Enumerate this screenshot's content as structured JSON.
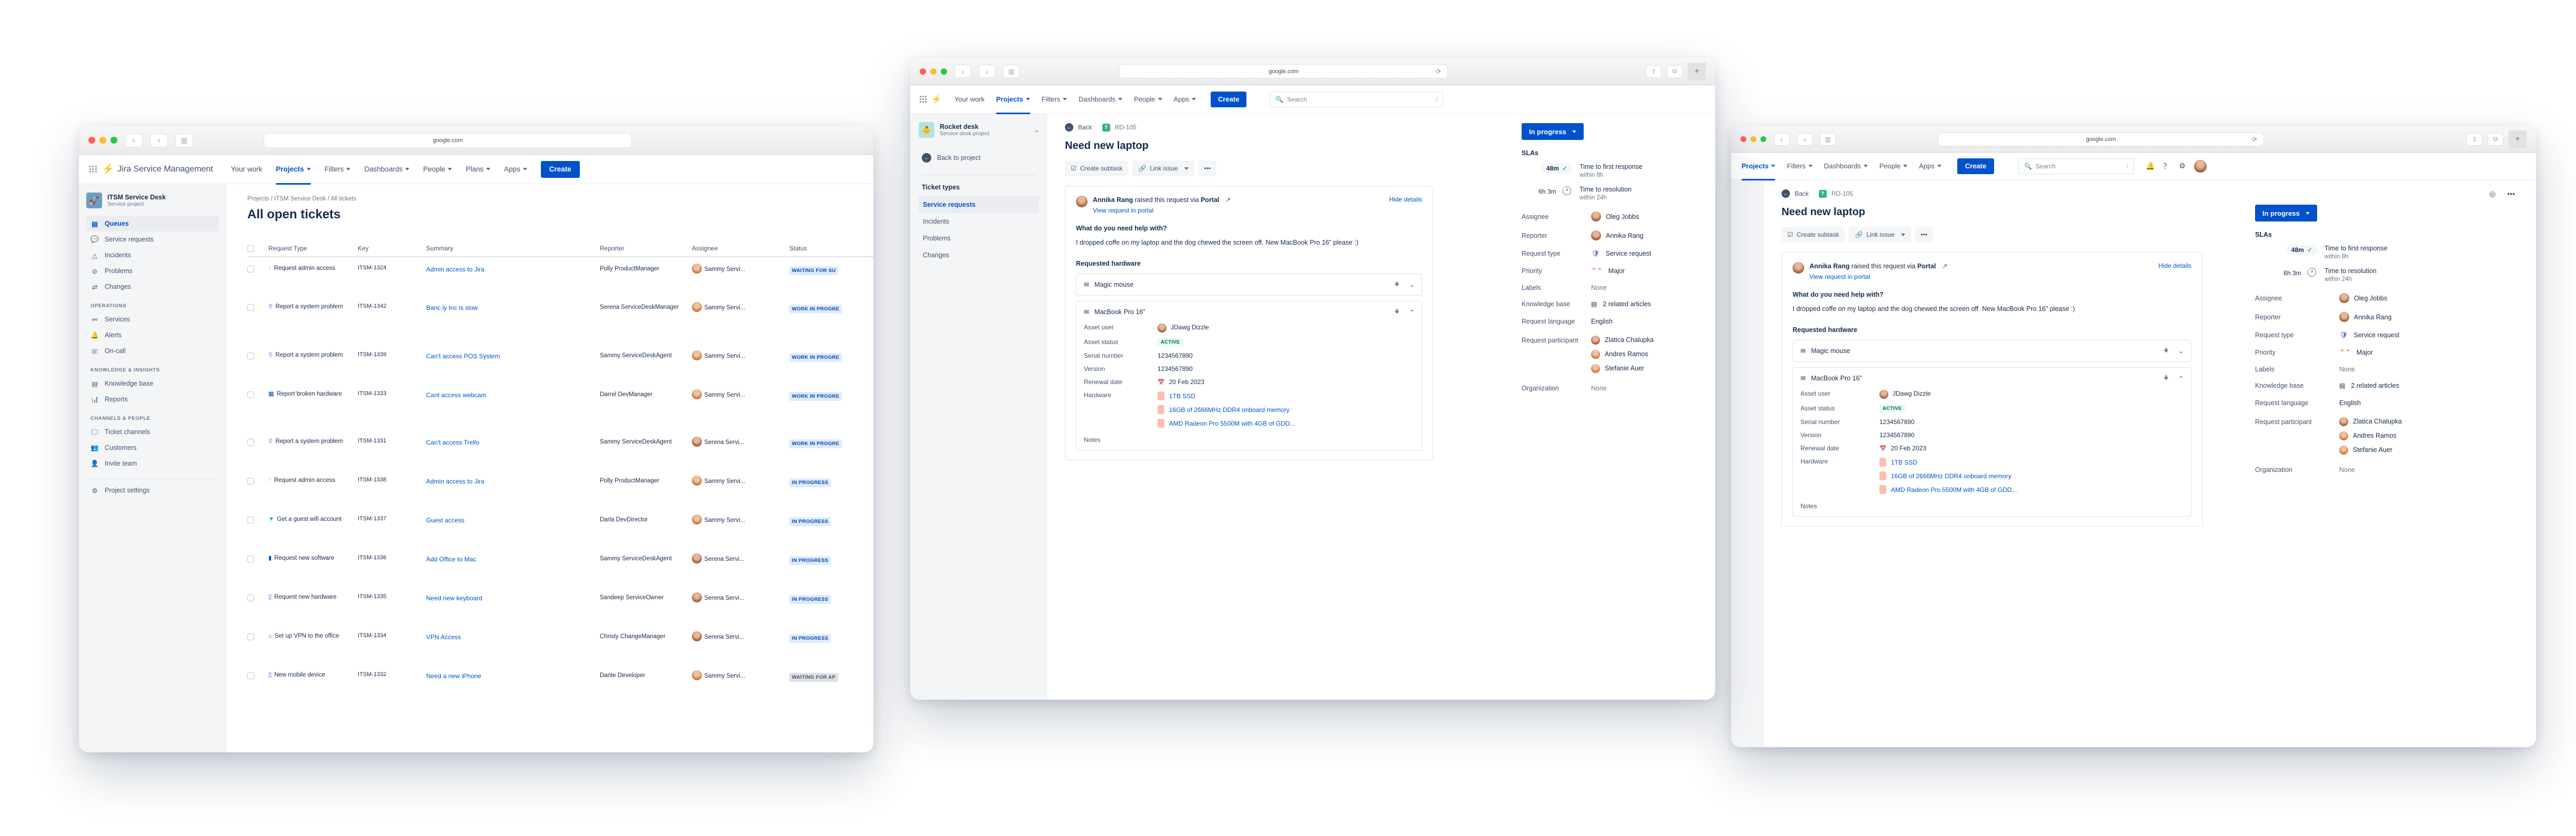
{
  "browser": {
    "url": "google.com"
  },
  "window1": {
    "brand": "Jira Service Management",
    "nav": [
      {
        "label": "Your work",
        "caret": false,
        "active": false
      },
      {
        "label": "Projects",
        "caret": true,
        "active": true
      },
      {
        "label": "Filters",
        "caret": true,
        "active": false
      },
      {
        "label": "Dashboards",
        "caret": true,
        "active": false
      },
      {
        "label": "People",
        "caret": true,
        "active": false
      },
      {
        "label": "Plans",
        "caret": true,
        "active": false
      },
      {
        "label": "Apps",
        "caret": true,
        "active": false
      }
    ],
    "create_label": "Create",
    "sidebar": {
      "project_name": "ITSM Service Desk",
      "project_type": "Service project",
      "items": [
        {
          "label": "Queues",
          "icon": "queues-icon",
          "selected": true
        },
        {
          "label": "Service requests",
          "icon": "chat-icon",
          "selected": false
        },
        {
          "label": "Incidents",
          "icon": "warning-icon",
          "selected": false
        },
        {
          "label": "Problems",
          "icon": "forbidden-icon",
          "selected": false
        },
        {
          "label": "Changes",
          "icon": "shuffle-icon",
          "selected": false
        }
      ],
      "sections": [
        {
          "title": "OPERATIONS",
          "items": [
            {
              "label": "Services",
              "icon": "services-icon"
            },
            {
              "label": "Alerts",
              "icon": "bell-icon"
            },
            {
              "label": "On-call",
              "icon": "oncall-icon"
            }
          ]
        },
        {
          "title": "KNOWLEDGE & INSIGHTS",
          "items": [
            {
              "label": "Knowledge base",
              "icon": "book-icon"
            },
            {
              "label": "Reports",
              "icon": "chart-icon"
            }
          ]
        },
        {
          "title": "CHANNELS & PEOPLE",
          "items": [
            {
              "label": "Ticket channels",
              "icon": "monitor-icon"
            },
            {
              "label": "Customers",
              "icon": "people-icon"
            },
            {
              "label": "Invite team",
              "icon": "person-add-icon"
            }
          ]
        }
      ],
      "footer_item": {
        "label": "Project settings",
        "icon": "gear-icon"
      }
    },
    "breadcrumb": "Projects / ITSM Service Desk / All tickets",
    "page_title": "All open tickets",
    "table": {
      "columns": [
        "Request Type",
        "Key",
        "Summary",
        "Reporter",
        "Assignee",
        "Status"
      ],
      "rows": [
        {
          "type": "Request admin access",
          "type_icon": "arrow-up-icon",
          "key": "ITSM-1324",
          "summary": "Admin access to Jira",
          "reporter": "Polly ProductManager",
          "assignee": "Sammy Servi...",
          "status": "WAITING FOR SU",
          "status_style": "blue"
        },
        {
          "type": "Report a system problem",
          "type_icon": "person-icon",
          "key": "ITSM-1342",
          "summary": "Banc.ly Inc is slow",
          "reporter": "Serena ServiceDeskManager",
          "assignee": "Sammy Servi...",
          "status": "WORK IN PROGRE",
          "status_style": "blue"
        },
        {
          "type": "Report a system problem",
          "type_icon": "person-icon",
          "key": "ITSM-1339",
          "summary": "Can't access POS System",
          "reporter": "Sammy ServiceDeskAgent",
          "assignee": "Sammy Servi...",
          "status": "WORK IN PROGRE",
          "status_style": "blue"
        },
        {
          "type": "Report broken hardware",
          "type_icon": "hardware-icon",
          "key": "ITSM-1333",
          "summary": "Cant access webcam",
          "reporter": "Darrel DevManager",
          "assignee": "Sammy Servi...",
          "status": "WORK IN PROGRE",
          "status_style": "blue"
        },
        {
          "type": "Report a system problem",
          "type_icon": "person-icon",
          "key": "ITSM-1331",
          "summary": "Can't access Trello",
          "reporter": "Sammy ServiceDeskAgent",
          "assignee": "Serena Servi...",
          "status": "WORK IN PROGRE",
          "status_style": "blue"
        },
        {
          "type": "Request admin access",
          "type_icon": "arrow-up-icon",
          "key": "ITSM-1338",
          "summary": "Admin access to Jira",
          "reporter": "Polly ProductManager",
          "assignee": "Sammy Servi...",
          "status": "IN PROGRESS",
          "status_style": "blue"
        },
        {
          "type": "Get a guest wifi account",
          "type_icon": "wifi-icon",
          "key": "ITSM-1337",
          "summary": "Guest access",
          "reporter": "Darla DevDirector",
          "assignee": "Sammy Servi...",
          "status": "IN PROGRESS",
          "status_style": "blue"
        },
        {
          "type": "Request new software",
          "type_icon": "software-icon",
          "key": "ITSM-1336",
          "summary": "Add Office to Mac",
          "reporter": "Sammy ServiceDeskAgent",
          "assignee": "Serena Servi...",
          "status": "IN PROGRESS",
          "status_style": "blue"
        },
        {
          "type": "Request new hardware",
          "type_icon": "newhw-icon",
          "key": "ITSM-1335",
          "summary": "Need new keyboard",
          "reporter": "Sandeep ServiceOwner",
          "assignee": "Serena Servi...",
          "status": "IN PROGRESS",
          "status_style": "blue"
        },
        {
          "type": "Set up VPN to the office",
          "type_icon": "vpn-icon",
          "key": "ITSM-1334",
          "summary": "VPN Access",
          "reporter": "Christy ChangeManager",
          "assignee": "Serena Servi...",
          "status": "IN PROGRESS",
          "status_style": "blue"
        },
        {
          "type": "New mobile device",
          "type_icon": "mobile-icon",
          "key": "ITSM-1332",
          "summary": "Need a new iPhone",
          "reporter": "Dante Developer",
          "assignee": "Sammy Servi...",
          "status": "WAITING FOR AP",
          "status_style": "grey"
        }
      ]
    }
  },
  "issue": {
    "nav": [
      {
        "label": "Your work",
        "caret": false,
        "active": false
      },
      {
        "label": "Projects",
        "caret": true,
        "active": true
      },
      {
        "label": "Filters",
        "caret": true,
        "active": false
      },
      {
        "label": "Dashboards",
        "caret": true,
        "active": false
      },
      {
        "label": "People",
        "caret": true,
        "active": false
      },
      {
        "label": "Apps",
        "caret": true,
        "active": false
      }
    ],
    "create_label": "Create",
    "search_placeholder": "Search",
    "search_hint": "/",
    "sidebar": {
      "project_name": "Rocket desk",
      "project_type": "Service desk project",
      "back_label": "Back to project",
      "group_title": "Ticket types",
      "items": [
        {
          "label": "Service requests",
          "selected": true
        },
        {
          "label": "Incidents",
          "selected": false
        },
        {
          "label": "Problems",
          "selected": false
        },
        {
          "label": "Changes",
          "selected": false
        }
      ]
    },
    "back_label": "Back",
    "issue_key": "RD-105",
    "title": "Need new laptop",
    "actions": {
      "subtask": "Create subtask",
      "link": "Link issue",
      "more": "•••"
    },
    "request": {
      "reporter": "Annika Rang",
      "raised_text": "raised this request via",
      "channel": "Portal",
      "hide_details": "Hide details",
      "portal_link": "View request in portal",
      "question": "What do you need help with?",
      "answer": "I dropped coffe on my laptop and the dog chewed the screen off. New MacBook Pro 16” please :)",
      "hardware_heading": "Requested hardware",
      "notes_label": "Notes"
    },
    "assets": [
      {
        "name": "Magic mouse",
        "expanded": false
      },
      {
        "name": "MacBook Pro 16”",
        "expanded": true,
        "fields": [
          {
            "label": "Asset user",
            "value": "JDawg Dizzle",
            "kind": "avatar"
          },
          {
            "label": "Asset status",
            "value": "ACTIVE",
            "kind": "pill"
          },
          {
            "label": "Serial number",
            "value": "1234567890",
            "kind": "text"
          },
          {
            "label": "Version",
            "value": "1234567890",
            "kind": "text"
          },
          {
            "label": "Renewal date",
            "value": "20 Feb 2023",
            "kind": "date"
          }
        ],
        "hardware_label": "Hardware",
        "hardware": [
          "1TB SSD",
          "16GB of 2666MHz DDR4 onboard memory",
          "AMD Radeon Pro 5500M with 4GB of GDD..."
        ]
      }
    ],
    "details": {
      "status": "In progress",
      "slas_heading": "SLAs",
      "slas": [
        {
          "time": "48m",
          "icon": "check-icon",
          "name": "Time to first response",
          "window": "within 8h"
        },
        {
          "time": "6h 3m",
          "icon": "clock-icon",
          "name": "Time to resolution",
          "window": "within 24h"
        }
      ],
      "fields": [
        {
          "label": "Assignee",
          "value": "Oleg Jobbs",
          "kind": "avatar"
        },
        {
          "label": "Reporter",
          "value": "Annika Rang",
          "kind": "avatar"
        },
        {
          "label": "Request type",
          "value": "Service request",
          "kind": "shield"
        },
        {
          "label": "Priority",
          "value": "Major",
          "kind": "priority"
        },
        {
          "label": "Labels",
          "value": "None",
          "kind": "muted"
        },
        {
          "label": "Knowledge base",
          "value": "2 related articles",
          "kind": "kb"
        },
        {
          "label": "Request language",
          "value": "English",
          "kind": "text"
        }
      ],
      "participants_label": "Request participant",
      "participants": [
        "Zlatica Chalupka",
        "Andres Ramos",
        "Stefanie Auer"
      ],
      "organization_label": "Organization",
      "organization_value": "None"
    }
  },
  "colors": {
    "accent": "#0052CC",
    "green": "#36B37E",
    "red": "#DE350B",
    "purple": "#6554C0"
  }
}
